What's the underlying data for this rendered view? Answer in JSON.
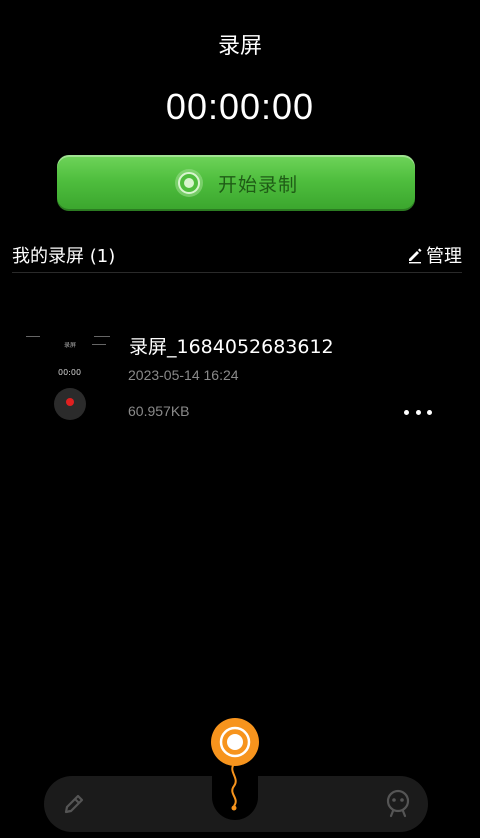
{
  "header": {
    "title": "录屏",
    "timer": "00:00:00"
  },
  "record_button": {
    "label": "开始录制",
    "icon": "record-icon"
  },
  "section": {
    "title": "我的录屏 (1)",
    "manage_label": "管理",
    "manage_icon": "edit-icon"
  },
  "recordings": [
    {
      "name": "录屏_1684052683612",
      "date": "2023-05-14 16:24",
      "size": "60.957KB",
      "thumbnail": {
        "label_top": "录屏",
        "timer_text": "00:00"
      },
      "more_icon": "more-dots-icon"
    }
  ],
  "bottom_nav": {
    "left_icon": "pencil-icon",
    "center_icon": "record-balloon-icon",
    "right_icon": "robot-face-icon"
  },
  "colors": {
    "background": "#000000",
    "record_green": "#4fbe3e",
    "accent_orange": "#f7941d",
    "secondary_text": "#8a8a8a"
  }
}
